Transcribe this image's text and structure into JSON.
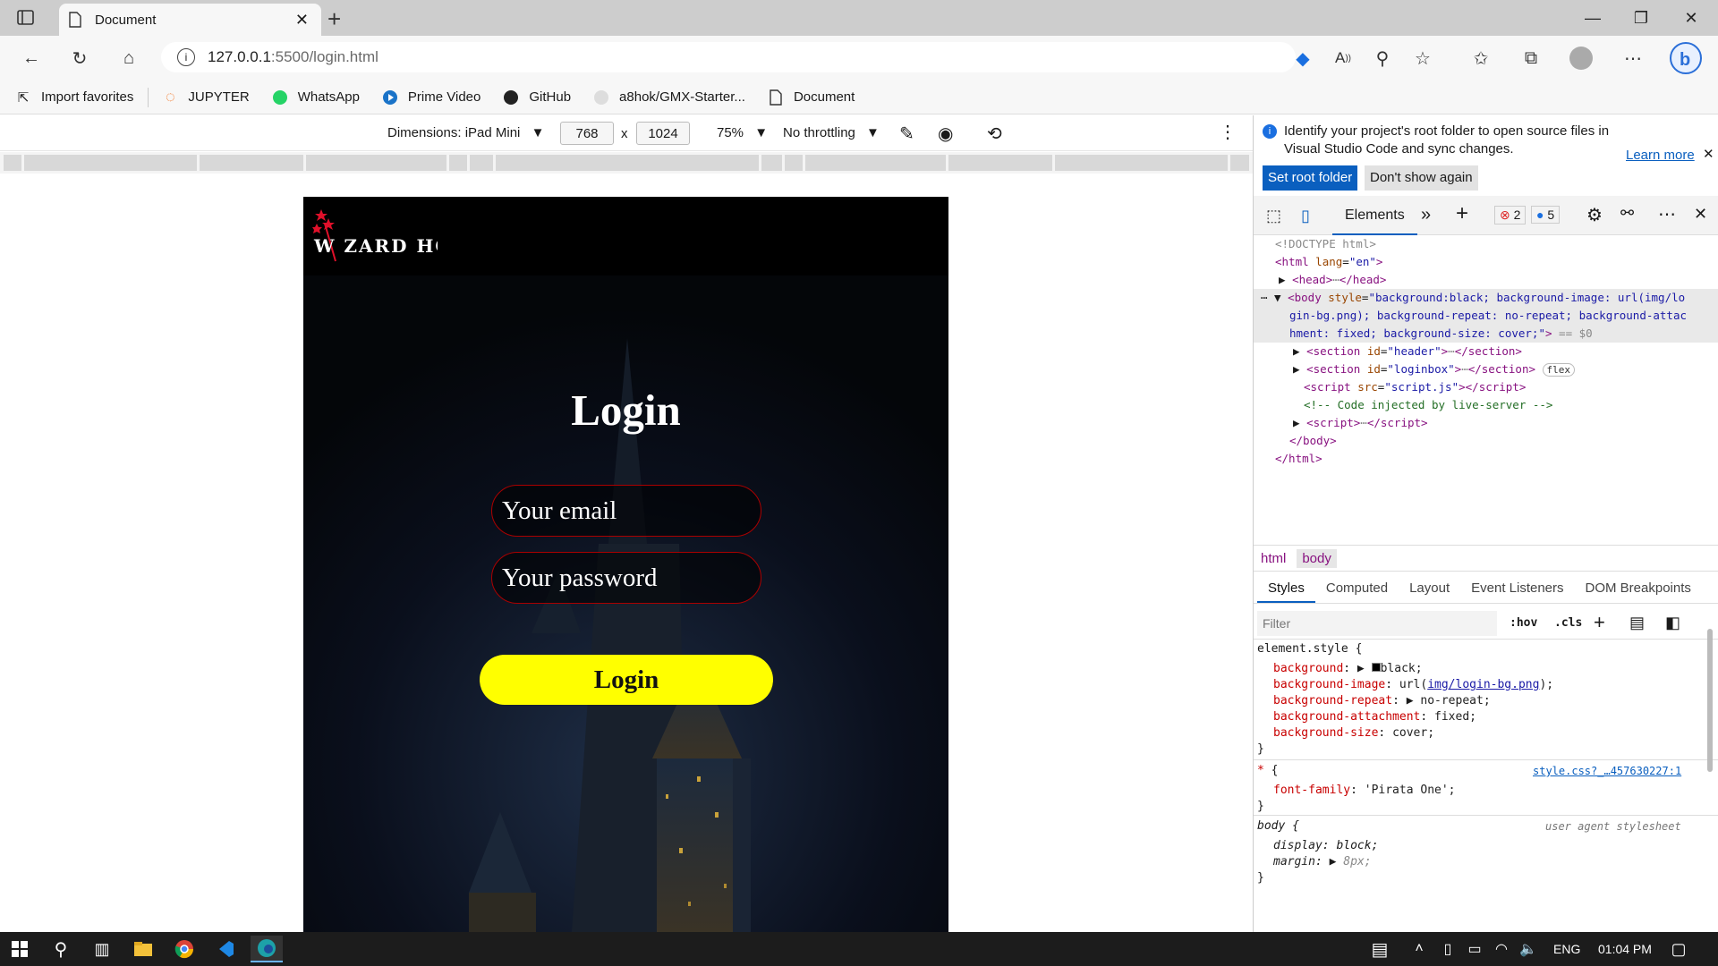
{
  "browser": {
    "tab_title": "Document",
    "address": "127.0.0.1",
    "address_path": ":5500/login.html",
    "favorites": [
      "Import favorites",
      "JUPYTER",
      "WhatsApp",
      "Prime Video",
      "GitHub",
      "a8hok/GMX-Starter...",
      "Document"
    ]
  },
  "device_toolbar": {
    "dimensions": "Dimensions: iPad Mini",
    "width": "768",
    "times": "x",
    "height": "1024",
    "zoom": "75%",
    "throttle": "No throttling"
  },
  "page": {
    "logo": "W ZARD HOUSE",
    "title": "Login",
    "email_placeholder": "Your email",
    "password_placeholder": "Your password",
    "button": "Login"
  },
  "devtools": {
    "banner_text": "Identify your project's root folder to open source files in Visual Studio Code and sync changes.",
    "learn_more": "Learn more",
    "set_root": "Set root folder",
    "dont_show": "Don't show again",
    "elements_tab": "Elements",
    "errors": "2",
    "messages": "5",
    "crumbs": [
      "html",
      "body"
    ],
    "subtabs": [
      "Styles",
      "Computed",
      "Layout",
      "Event Listeners",
      "DOM Breakpoints"
    ],
    "filter_placeholder": "Filter",
    "hov": ":hov",
    "cls": ".cls",
    "dom_flex_badge": "flex",
    "style_link": "style.css?_…457630227:1",
    "ua_label": "user agent stylesheet"
  },
  "taskbar": {
    "lang": "ENG",
    "time": "01:04 PM"
  },
  "colors": {
    "button_yellow": "#ffff00",
    "input_border": "#aa0000",
    "link_blue": "#0a5fbf"
  }
}
